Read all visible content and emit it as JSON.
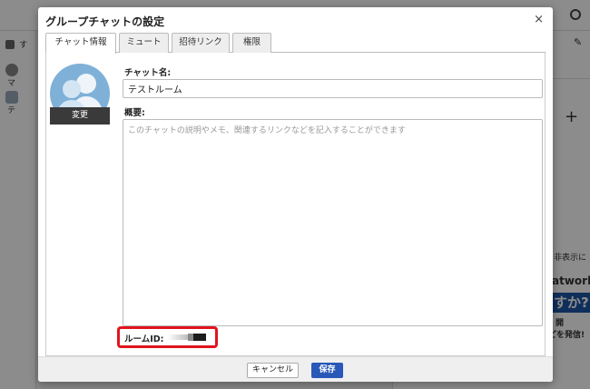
{
  "background": {
    "sidebar": [
      {
        "icon": "home-icon",
        "label": "す"
      },
      {
        "icon": "user-icon",
        "label": "マ"
      },
      {
        "icon": "group-icon",
        "label": "テ"
      }
    ],
    "ad": {
      "line1": "非表示に",
      "line2": "atwork",
      "line3": "すか?",
      "line4": "開",
      "line5": "どを発信!"
    }
  },
  "dialog": {
    "title": "グループチャットの設定",
    "close": "×",
    "tabs": [
      {
        "label": "チャット情報",
        "active": true
      },
      {
        "label": "ミュート",
        "active": false
      },
      {
        "label": "招待リンク",
        "active": false
      },
      {
        "label": "権限",
        "active": false
      }
    ],
    "avatar": {
      "change_label": "変更"
    },
    "name": {
      "label": "チャット名:",
      "value": "テストルーム"
    },
    "description": {
      "label": "概要:",
      "value": "",
      "placeholder": "このチャットの説明やメモ、関連するリンクなどを記入することができます"
    },
    "room_id": {
      "label": "ルームID:"
    },
    "footer": {
      "cancel": "キャンセル",
      "save": "保存"
    }
  },
  "colors": {
    "save_button": "#2958b8",
    "highlight_border": "#e0141e",
    "avatar_bg": "#7fb0d8"
  }
}
